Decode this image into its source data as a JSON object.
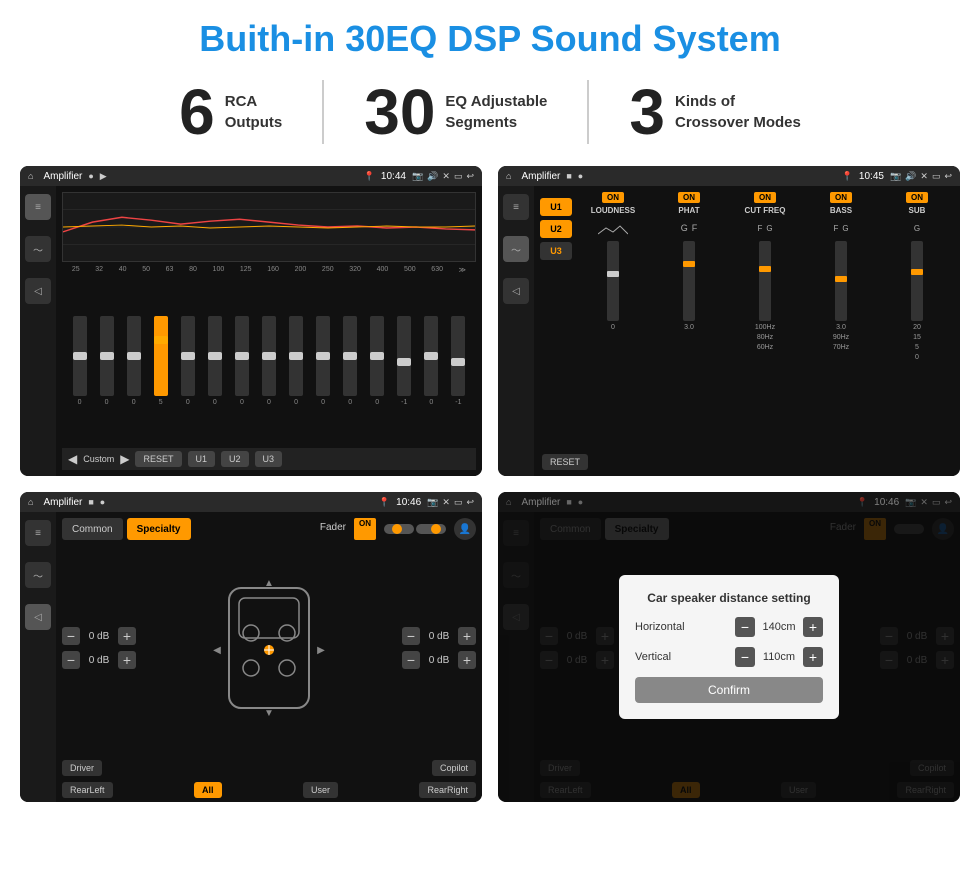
{
  "header": {
    "title": "Buith-in 30EQ DSP Sound System"
  },
  "stats": [
    {
      "number": "6",
      "line1": "RCA",
      "line2": "Outputs"
    },
    {
      "number": "30",
      "line1": "EQ Adjustable",
      "line2": "Segments"
    },
    {
      "number": "3",
      "line1": "Kinds of",
      "line2": "Crossover Modes"
    }
  ],
  "screens": [
    {
      "id": "eq-screen",
      "status_bar": {
        "title": "Amplifier",
        "time": "10:44"
      }
    },
    {
      "id": "crossover-screen",
      "status_bar": {
        "title": "Amplifier",
        "time": "10:45"
      }
    },
    {
      "id": "fader-screen",
      "status_bar": {
        "title": "Amplifier",
        "time": "10:46"
      }
    },
    {
      "id": "distance-screen",
      "status_bar": {
        "title": "Amplifier",
        "time": "10:46"
      },
      "dialog": {
        "title": "Car speaker distance setting",
        "horizontal_label": "Horizontal",
        "horizontal_value": "140cm",
        "vertical_label": "Vertical",
        "vertical_value": "110cm",
        "confirm_label": "Confirm"
      }
    }
  ],
  "eq": {
    "frequencies": [
      "25",
      "32",
      "40",
      "50",
      "63",
      "80",
      "100",
      "125",
      "160",
      "200",
      "250",
      "320",
      "400",
      "500",
      "630"
    ],
    "values": [
      "0",
      "0",
      "0",
      "5",
      "0",
      "0",
      "0",
      "0",
      "0",
      "0",
      "0",
      "0",
      "-1",
      "0",
      "-1"
    ],
    "preset": "Custom",
    "buttons": [
      "RESET",
      "U1",
      "U2",
      "U3"
    ]
  },
  "crossover": {
    "presets": [
      "U1",
      "U2",
      "U3"
    ],
    "controls": [
      {
        "label": "LOUDNESS",
        "on": true
      },
      {
        "label": "PHAT",
        "on": true
      },
      {
        "label": "CUT FREQ",
        "on": true
      },
      {
        "label": "BASS",
        "on": true
      },
      {
        "label": "SUB",
        "on": true
      }
    ],
    "reset_label": "RESET"
  },
  "fader": {
    "tabs": [
      "Common",
      "Specialty"
    ],
    "active_tab": "Specialty",
    "fader_label": "Fader",
    "fader_on": "ON",
    "vol_rows": [
      {
        "value": "0 dB"
      },
      {
        "value": "0 dB"
      },
      {
        "value": "0 dB"
      },
      {
        "value": "0 dB"
      }
    ],
    "bottom_buttons": [
      "Driver",
      "",
      "Copilot",
      "RearLeft",
      "All",
      "User",
      "RearRight"
    ]
  },
  "distance": {
    "tabs": [
      "Common",
      "Specialty"
    ],
    "active_tab": "Common",
    "dialog_title": "Car speaker distance setting",
    "horizontal_label": "Horizontal",
    "horizontal_value": "140cm",
    "vertical_label": "Vertical",
    "vertical_value": "110cm",
    "confirm_label": "Confirm",
    "bottom_buttons": [
      "Driver",
      "Copilot",
      "RearLeft",
      "All",
      "User",
      "RearRight"
    ]
  }
}
